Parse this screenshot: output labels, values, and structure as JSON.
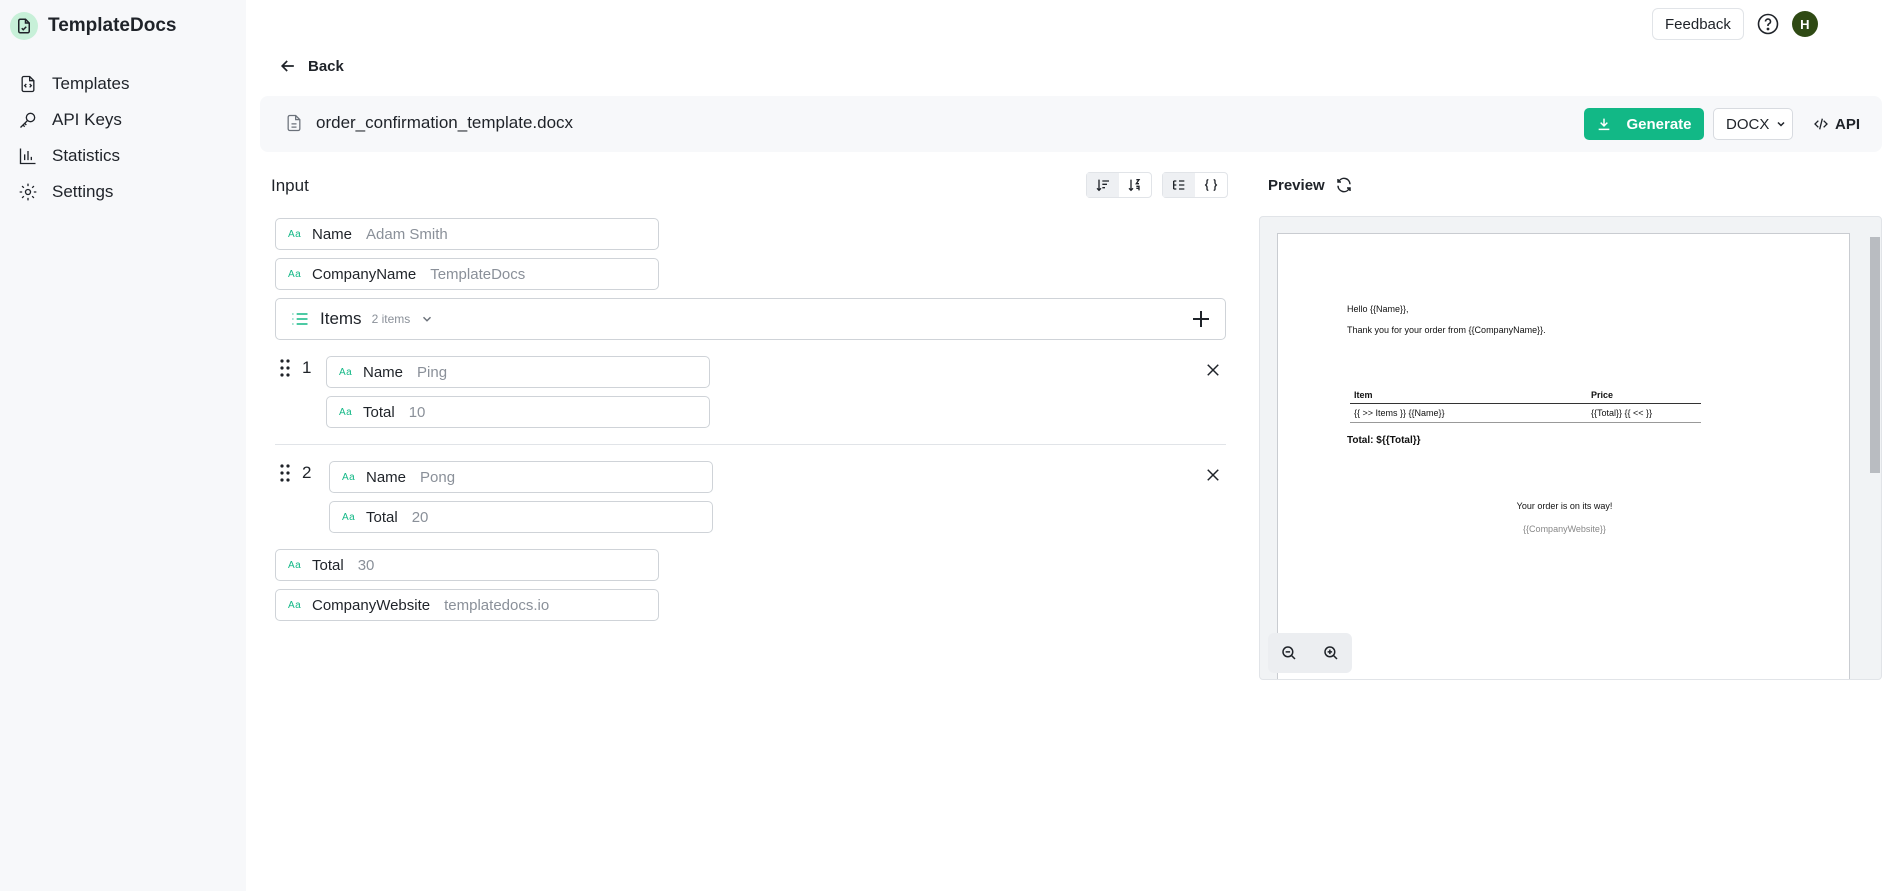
{
  "app": {
    "brand": "TemplateDocs"
  },
  "sidebar": {
    "items": [
      {
        "label": "Templates",
        "icon": "file-code-icon"
      },
      {
        "label": "API Keys",
        "icon": "key-icon"
      },
      {
        "label": "Statistics",
        "icon": "bar-chart-icon"
      },
      {
        "label": "Settings",
        "icon": "gear-icon"
      }
    ]
  },
  "topbar": {
    "feedback_label": "Feedback",
    "avatar_initial": "H"
  },
  "back_label": "Back",
  "file": {
    "name": "order_confirmation_template.docx",
    "generate_label": "Generate",
    "format": "DOCX",
    "api_label": "API"
  },
  "input": {
    "title": "Input",
    "fields": {
      "name": {
        "label": "Name",
        "value": "Adam Smith"
      },
      "company_name": {
        "label": "CompanyName",
        "value": "TemplateDocs"
      },
      "total": {
        "label": "Total",
        "value": "30"
      },
      "company_website": {
        "label": "CompanyWebsite",
        "value": "templatedocs.io"
      }
    },
    "items": {
      "label": "Items",
      "count": "2 items",
      "rows": [
        {
          "index": "1",
          "name_label": "Name",
          "name_value": "Ping",
          "total_label": "Total",
          "total_value": "10"
        },
        {
          "index": "2",
          "name_label": "Name",
          "name_value": "Pong",
          "total_label": "Total",
          "total_value": "20"
        }
      ]
    }
  },
  "preview": {
    "title": "Preview",
    "doc": {
      "greeting": "Hello {{Name}},",
      "thanks": "Thank you for your order from {{CompanyName}}.",
      "col_item": "Item",
      "col_price": "Price",
      "row_item": "{{ >> Items }} {{Name}}",
      "row_price": "{{Total}} {{ << }}",
      "total_line": "Total: ${{Total}}",
      "on_way": "Your order is on its way!",
      "website": "{{CompanyWebsite}}"
    }
  },
  "colors": {
    "accent": "#12b886",
    "sidebar_bg": "#f7f8fa",
    "avatar_bg": "#2f4a14"
  }
}
